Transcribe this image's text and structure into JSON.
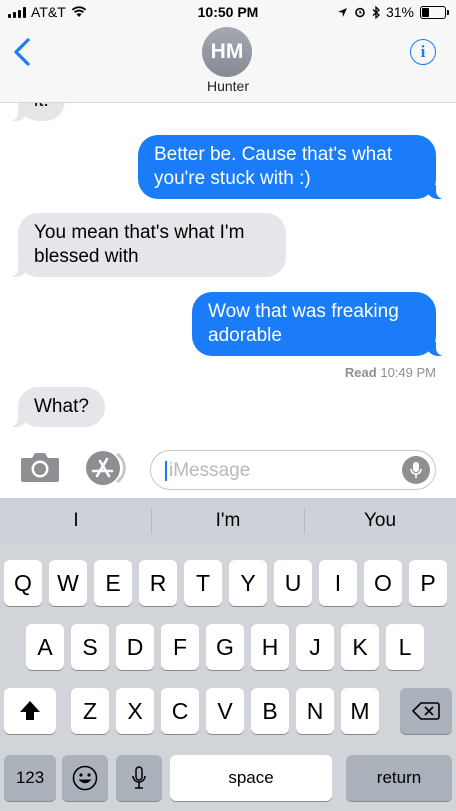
{
  "status_bar": {
    "carrier": "AT&T",
    "time": "10:50 PM",
    "battery_percent": "31%",
    "battery_level": 0.31,
    "icons": [
      "signal-icon",
      "wifi-icon",
      "location-icon",
      "alarm-icon",
      "bluetooth-icon",
      "battery-icon"
    ]
  },
  "header": {
    "back_icon": "chevron-left-icon",
    "avatar_initials": "HM",
    "contact_name": "Hunter",
    "info_icon": "info-icon",
    "info_glyph": "i"
  },
  "messages": [
    {
      "direction": "incoming",
      "text": "it."
    },
    {
      "direction": "outgoing",
      "text": "Better be. Cause that's what you're stuck with :)"
    },
    {
      "direction": "incoming",
      "text": "You mean that's what I'm blessed with"
    },
    {
      "direction": "outgoing",
      "text": "Wow that was freaking adorable"
    },
    {
      "direction": "incoming",
      "text": "What?"
    }
  ],
  "read_receipt": {
    "label": "Read",
    "time": "10:49 PM"
  },
  "compose": {
    "placeholder": "iMessage",
    "camera_icon": "camera-icon",
    "apps_icon": "app-store-icon",
    "mic_icon": "microphone-icon"
  },
  "keyboard": {
    "predictions": [
      "I",
      "I'm",
      "You"
    ],
    "row1": [
      "Q",
      "W",
      "E",
      "R",
      "T",
      "Y",
      "U",
      "I",
      "O",
      "P"
    ],
    "row2": [
      "A",
      "S",
      "D",
      "F",
      "G",
      "H",
      "J",
      "K",
      "L"
    ],
    "row3": [
      "Z",
      "X",
      "C",
      "V",
      "B",
      "N",
      "M"
    ],
    "shift_icon": "shift-icon",
    "delete_icon": "backspace-icon",
    "numbers_label": "123",
    "emoji_icon": "emoji-icon",
    "dictation_icon": "microphone-icon",
    "space_label": "space",
    "return_label": "return"
  },
  "colors": {
    "accent_blue": "#1a7cf8",
    "incoming_bubble": "#e5e5ea",
    "keyboard_bg": "#d1d4d9",
    "dark_key": "#abb1ba"
  }
}
